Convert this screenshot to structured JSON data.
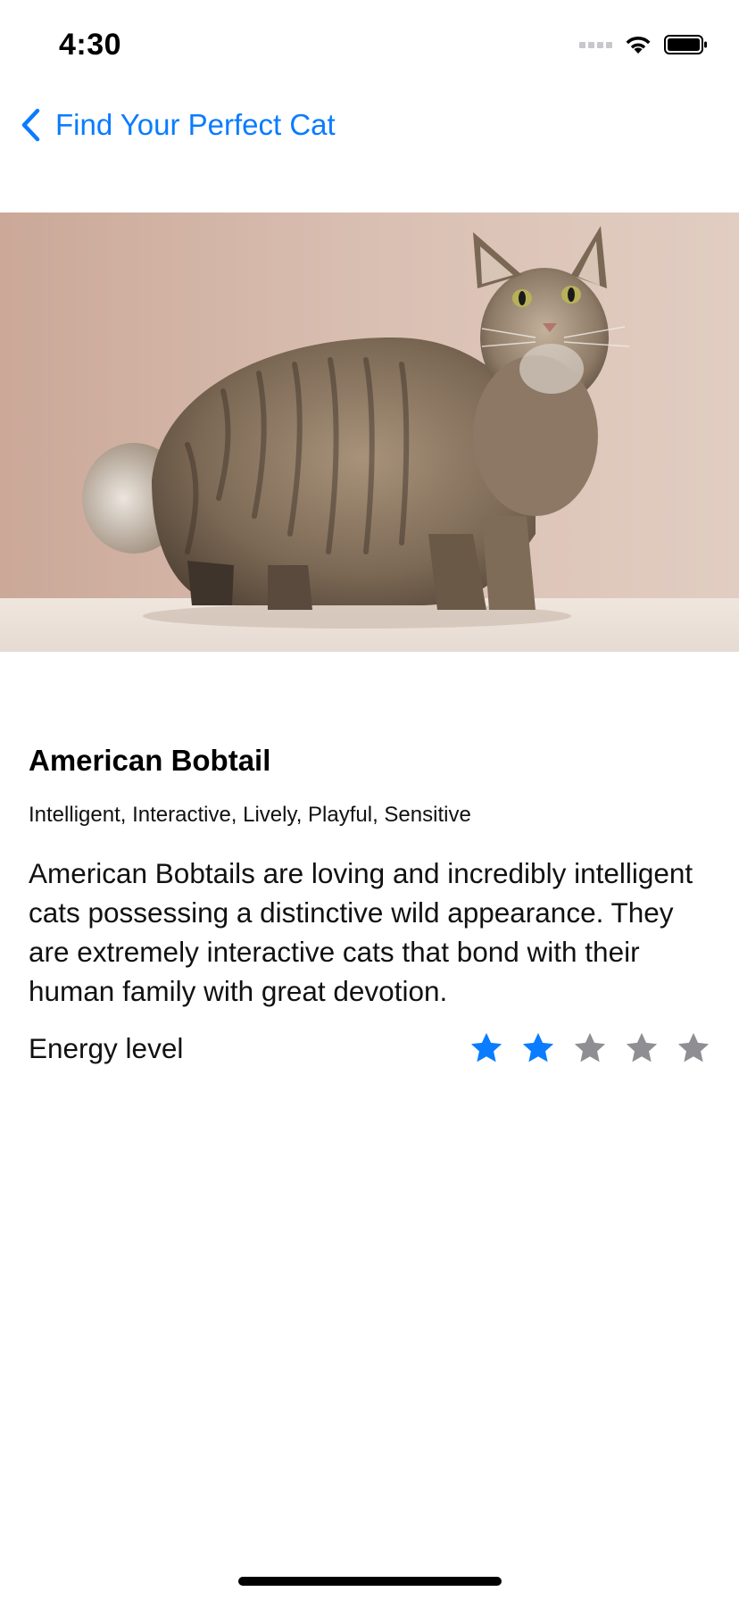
{
  "status_bar": {
    "time": "4:30"
  },
  "nav": {
    "back_label": "Find Your Perfect Cat",
    "back_icon": "chevron-left-icon",
    "accent_color": "#0a7cff"
  },
  "hero_image": {
    "subject": "cat-photo"
  },
  "breed": {
    "name": "American Bobtail",
    "temperament": "Intelligent, Interactive, Lively, Playful, Sensitive",
    "description": "American Bobtails are loving and incredibly intelligent cats possessing a distinctive wild appearance. They are extremely interactive cats that bond with their human family with great devotion.",
    "energy_label": "Energy level",
    "energy_level": 2,
    "energy_max": 5,
    "star_active_color": "#0a7cff",
    "star_inactive_color": "#8e8e93"
  }
}
